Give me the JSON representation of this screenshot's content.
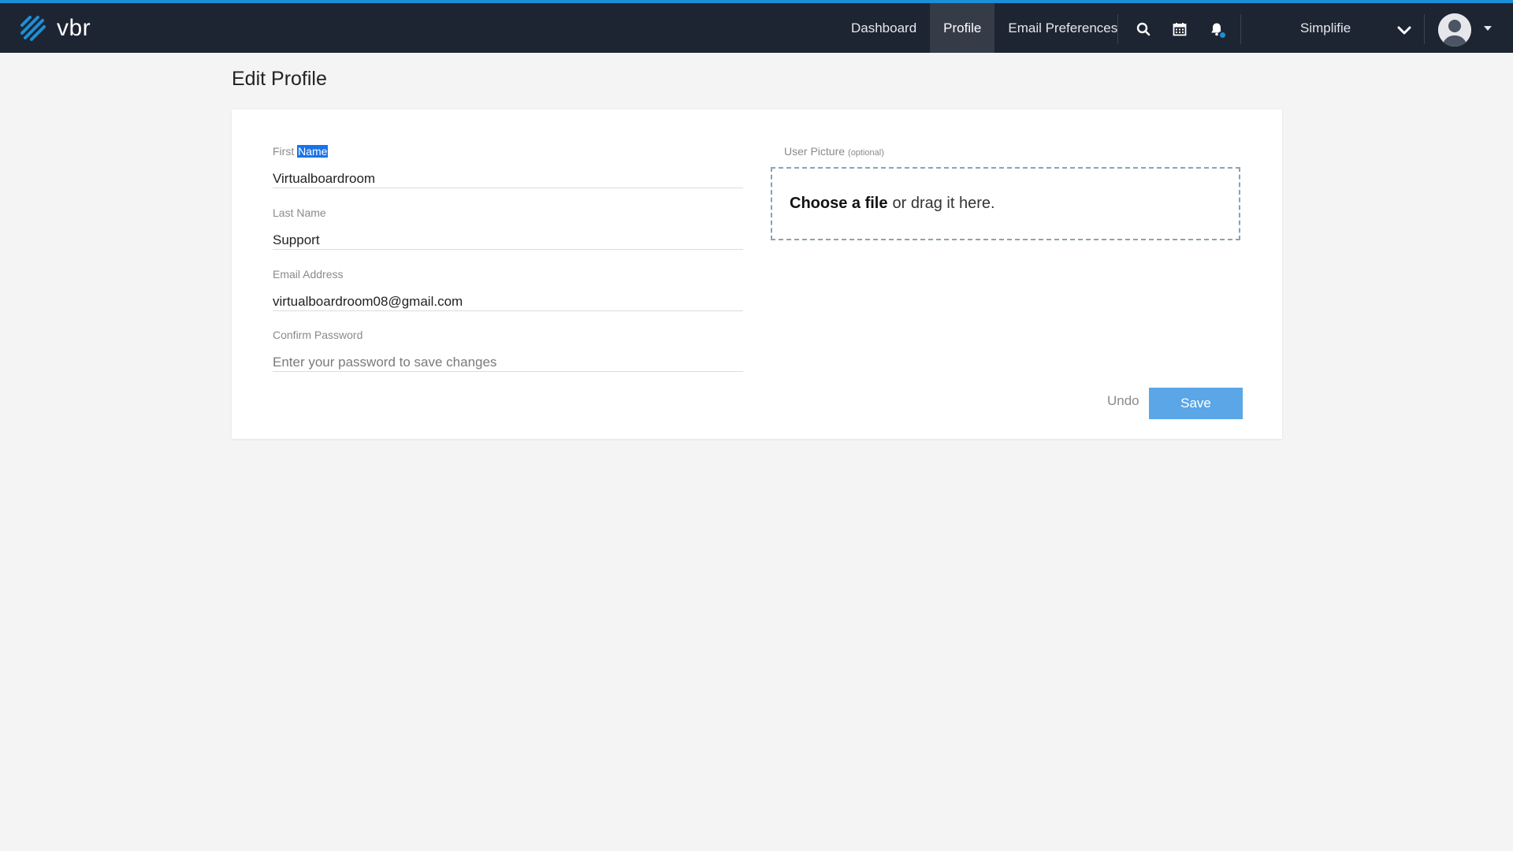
{
  "brand": {
    "name": "vbr",
    "accent": "#1c8fd8",
    "nav_bg": "#1e2532"
  },
  "nav": {
    "items": [
      {
        "label": "Dashboard",
        "active": false
      },
      {
        "label": "Profile",
        "active": true
      },
      {
        "label": "Email Preferences",
        "active": false
      }
    ],
    "icons": [
      "search-icon",
      "calendar-icon",
      "bell-icon"
    ],
    "org_name": "Simplifie"
  },
  "page": {
    "title": "Edit Profile"
  },
  "form": {
    "first_name": {
      "label_prefix": "First ",
      "label_highlight": "Name",
      "value": "Virtualboardroom"
    },
    "last_name": {
      "label": "Last Name",
      "value": "Support"
    },
    "email": {
      "label": "Email Address",
      "value": "virtualboardroom08@gmail.com"
    },
    "confirm_password": {
      "label": "Confirm Password",
      "placeholder": "Enter your password to save changes",
      "value": ""
    },
    "user_picture": {
      "label": "User Picture",
      "optional": "(optional)",
      "choose_label": "Choose a file",
      "drag_text": "or drag it here."
    },
    "undo_label": "Undo",
    "save_label": "Save",
    "save_color": "#5aa6e6"
  }
}
